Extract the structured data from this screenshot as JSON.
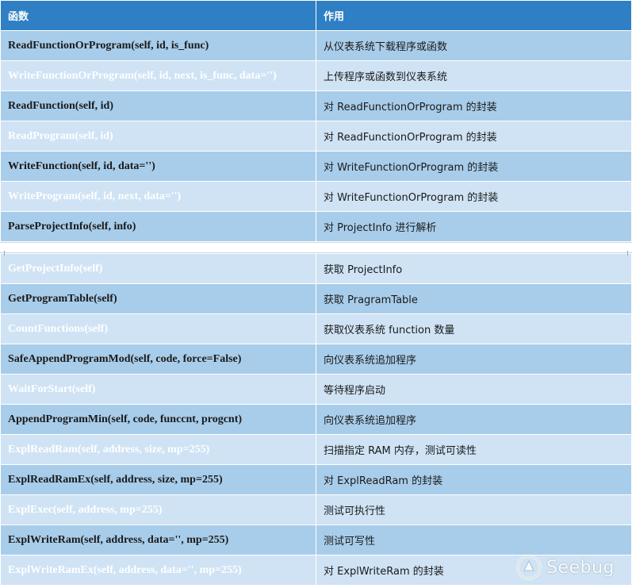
{
  "table": {
    "header": {
      "col1": "函数",
      "col2": "作用"
    },
    "group1": [
      {
        "fn": "ReadFunctionOrProgram(self, id, is_func)",
        "desc": "从仪表系统下载程序或函数",
        "shade": "dark"
      },
      {
        "fn": "WriteFunctionOrProgram(self, id, next, is_func, data='')",
        "desc": "上传程序或函数到仪表系统",
        "shade": "light"
      },
      {
        "fn": "ReadFunction(self, id)",
        "desc": "对 ReadFunctionOrProgram 的封装",
        "shade": "dark"
      },
      {
        "fn": "ReadProgram(self, id)",
        "desc": "对 ReadFunctionOrProgram 的封装",
        "shade": "light"
      },
      {
        "fn": "WriteFunction(self, id, data='')",
        "desc": "对 WriteFunctionOrProgram 的封装",
        "shade": "dark"
      },
      {
        "fn": "WriteProgram(self, id, next, data='')",
        "desc": "对 WriteFunctionOrProgram 的封装",
        "shade": "light"
      },
      {
        "fn": "ParseProjectInfo(self, info)",
        "desc": "对 ProjectInfo 进行解析",
        "shade": "dark"
      }
    ],
    "group2": [
      {
        "fn": "GetProjectInfo(self)",
        "desc": "获取 ProjectInfo",
        "shade": "light"
      },
      {
        "fn": "GetProgramTable(self)",
        "desc": "获取 PragramTable",
        "shade": "dark"
      },
      {
        "fn": "CountFunctions(self)",
        "desc": "获取仪表系统 function 数量",
        "shade": "light"
      },
      {
        "fn": "SafeAppendProgramMod(self, code, force=False)",
        "desc": "向仪表系统追加程序",
        "shade": "dark"
      },
      {
        "fn": "WaitForStart(self)",
        "desc": "等待程序启动",
        "shade": "light"
      },
      {
        "fn": "AppendProgramMin(self, code, funccnt, progcnt)",
        "desc": "向仪表系统追加程序",
        "shade": "dark"
      },
      {
        "fn": "ExplReadRam(self, address, size, mp=255)",
        "desc": "扫描指定 RAM 内存，测试可读性",
        "shade": "light"
      },
      {
        "fn": "ExplReadRamEx(self, address, size, mp=255)",
        "desc": "对 ExplReadRam 的封装",
        "shade": "dark"
      },
      {
        "fn": "ExplExec(self, address, mp=255)",
        "desc": "测试可执行性",
        "shade": "light"
      },
      {
        "fn": "ExplWriteRam(self, address, data='', mp=255)",
        "desc": "测试可写性",
        "shade": "dark"
      },
      {
        "fn": "ExplWriteRamEx(self, address, data='', mp=255)",
        "desc": "对 ExplWriteRam 的封装",
        "shade": "light"
      }
    ]
  },
  "watermark": {
    "text": "Seebug",
    "icon": "seebug-logo-icon"
  }
}
